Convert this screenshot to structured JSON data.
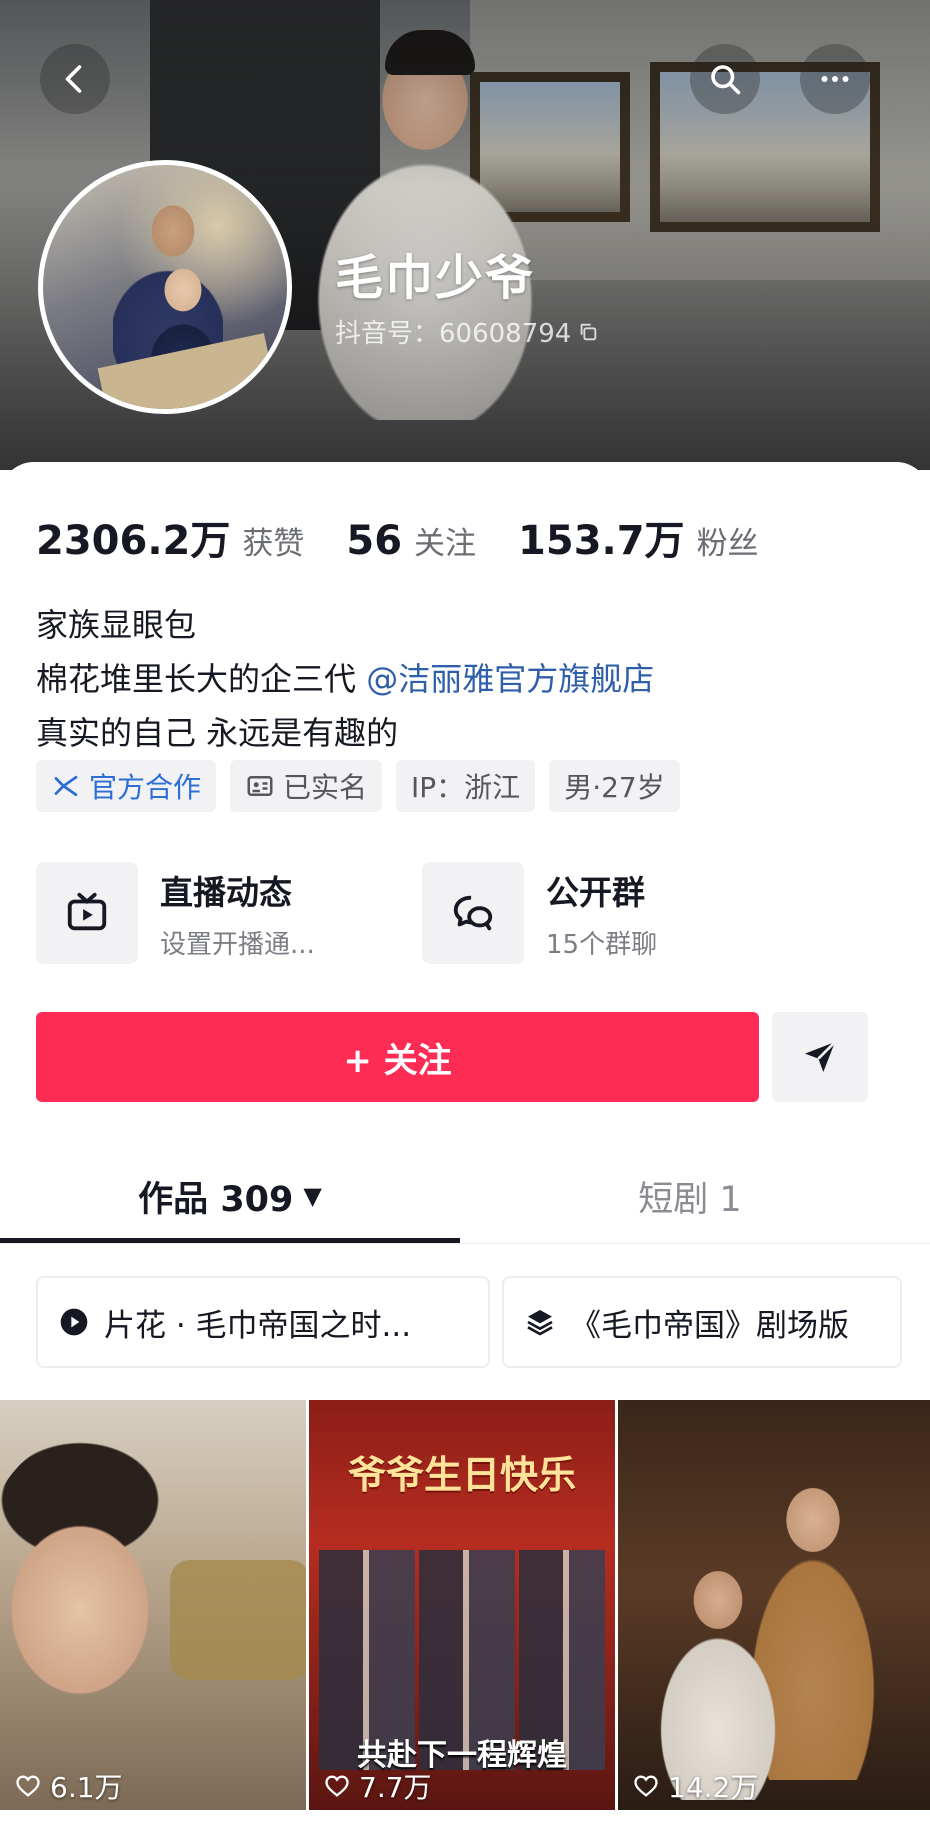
{
  "profile": {
    "name": "毛巾少爷",
    "douyin_id": "抖音号：60608794"
  },
  "stats": [
    {
      "value": "2306.2万",
      "label": "获赞"
    },
    {
      "value": "56",
      "label": "关注"
    },
    {
      "value": "153.7万",
      "label": "粉丝"
    }
  ],
  "bio": {
    "line1": "家族显眼包",
    "line2_text": "棉花堆里长大的企三代 ",
    "line2_mention": "@洁丽雅官方旗舰店",
    "line3": "真实的自己 永远是有趣的"
  },
  "tags": {
    "official": "官方合作",
    "verified": "已实名",
    "ip": "IP：浙江",
    "gender_age": "男·27岁"
  },
  "features": {
    "live": {
      "title": "直播动态",
      "subtitle": "设置开播通..."
    },
    "group": {
      "title": "公开群",
      "subtitle": "15个群聊"
    }
  },
  "actions": {
    "follow_label": "+ 关注"
  },
  "tabs": {
    "works": "作品 309",
    "works_caret": "▼",
    "drama": "短剧 1"
  },
  "playlists": [
    {
      "label": "片花 · 毛巾帝国之时..."
    },
    {
      "label": "《毛巾帝国》剧场版"
    }
  ],
  "videos": [
    {
      "likes": "6.1万"
    },
    {
      "likes": "7.7万",
      "overlay_title": "爷爷生日快乐",
      "overlay_bottom": "共赴下一程辉煌"
    },
    {
      "likes": "14.2万"
    }
  ],
  "colors": {
    "follow_button": "#fe2c55",
    "mention": "#2f5fa8",
    "official_tag": "#2b6fd6"
  },
  "icons": {
    "back": "back-arrow-icon",
    "search": "search-icon",
    "more": "more-dots-icon",
    "copy": "copy-icon",
    "official": "official-badge-icon",
    "verified": "id-card-icon",
    "live": "tv-icon",
    "group": "chat-bubbles-icon",
    "share": "send-icon",
    "playlist1": "play-icon",
    "playlist2": "layers-icon",
    "likes": "heart-icon"
  }
}
